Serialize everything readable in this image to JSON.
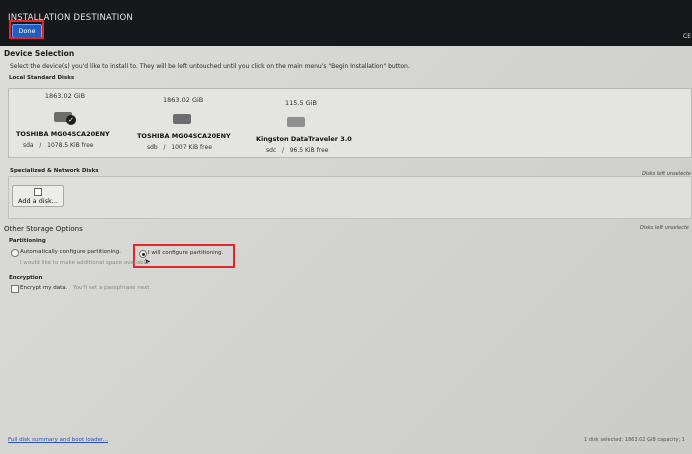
{
  "header": {
    "title": "INSTALLATION DESTINATION",
    "done_label": "Done",
    "lang_label": "CE"
  },
  "device_selection": {
    "heading": "Device Selection",
    "instruction": "Select the device(s) you'd like to install to.  They will be left untouched until you click on the main menu's \"Begin Installation\" button.",
    "local_heading": "Local Standard Disks",
    "disks": [
      {
        "size": "1863.02 GiB",
        "name": "TOSHIBA MG04SCA20ENY",
        "device": "sda",
        "free": "1078.5 KiB free",
        "selected": true
      },
      {
        "size": "1863.02 GiB",
        "name": "TOSHIBA MG04SCA20ENY",
        "device": "sdb",
        "free": "1007 KiB free",
        "selected": false
      },
      {
        "size": "115.5 GiB",
        "name": "Kingston DataTraveler 3.0",
        "device": "sdc",
        "free": "96.5 KiB free",
        "selected": false
      }
    ],
    "separator": "/",
    "disks_left_note": "Disks left unselecte"
  },
  "specialized": {
    "heading": "Specialized & Network Disks",
    "add_disk_label": "Add a disk...",
    "disks_left_note": "Disks left unselecte"
  },
  "other_storage": {
    "heading": "Other Storage Options",
    "partitioning_heading": "Partitioning",
    "auto_label": "Automatically configure partitioning.",
    "manual_label": "I will configure partitioning.",
    "extra_space_label": "I would like to make additional space available.",
    "encryption_heading": "Encryption",
    "encrypt_label": "Encrypt my data.",
    "encrypt_hint": "You'll set a passphrase next."
  },
  "footer": {
    "summary_link": "Full disk summary and boot loader...",
    "status": "1 disk selected; 1863.02 GiB capacity; 1"
  }
}
